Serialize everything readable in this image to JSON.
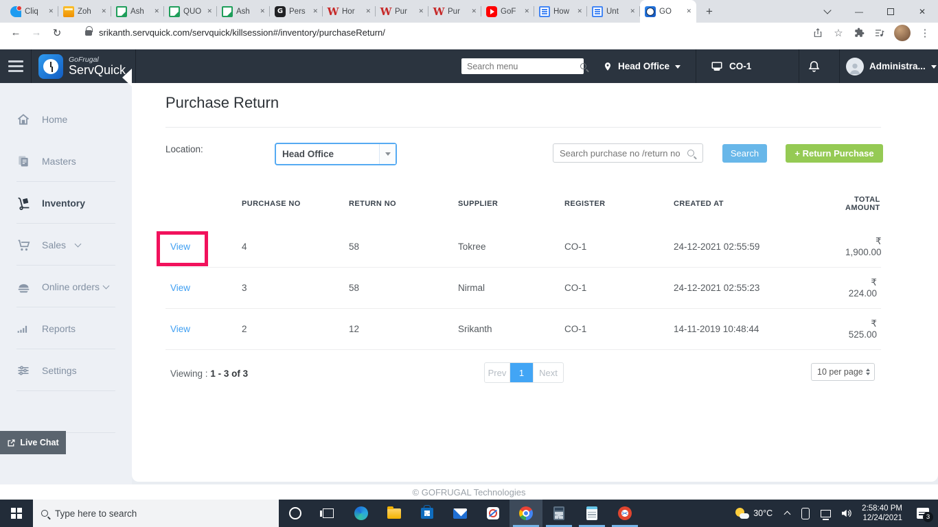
{
  "browser": {
    "tab_strip": {
      "tabs": [
        {
          "label": "Cliq",
          "icon": "cliq"
        },
        {
          "label": "Zoh",
          "icon": "folder"
        },
        {
          "label": "Ash",
          "icon": "sheet"
        },
        {
          "label": "QUO",
          "icon": "sheet"
        },
        {
          "label": "Ash",
          "icon": "sheet"
        },
        {
          "label": "Pers",
          "icon": "g"
        },
        {
          "label": "Hor",
          "icon": "w"
        },
        {
          "label": "Pur",
          "icon": "w"
        },
        {
          "label": "Pur",
          "icon": "w"
        },
        {
          "label": "GoF",
          "icon": "youtube"
        },
        {
          "label": "How",
          "icon": "doc"
        },
        {
          "label": "Unt",
          "icon": "doc"
        },
        {
          "label": "GO",
          "icon": "clock",
          "active": true
        }
      ],
      "new_tab_label": "+",
      "close_glyph": "✕"
    },
    "toolbar": {
      "url": "srikanth.servquick.com/servquick/killsession#/inventory/purchaseReturn/",
      "back": "←",
      "forward": "→",
      "reload": "↻",
      "star": "☆",
      "menu_dots": "⋮"
    }
  },
  "app": {
    "logo": {
      "brand": "GoFrugal",
      "product": "ServQuick"
    },
    "header": {
      "menu_search_placeholder": "Search menu",
      "location": "Head Office",
      "register": "CO-1",
      "user": "Administra..."
    },
    "sidebar": {
      "items": [
        {
          "label": "Home"
        },
        {
          "label": "Masters"
        },
        {
          "label": "Inventory"
        },
        {
          "label": "Sales"
        },
        {
          "label": "Online orders"
        },
        {
          "label": "Reports"
        },
        {
          "label": "Settings"
        }
      ],
      "live_chat": "Live Chat"
    },
    "main": {
      "title": "Purchase Return",
      "location_label": "Location:",
      "location_value": "Head Office",
      "search_placeholder": "Search purchase no /return no",
      "search_button": "Search",
      "return_button": "+ Return Purchase",
      "table": {
        "columns": [
          "PURCHASE NO",
          "RETURN NO",
          "SUPPLIER",
          "REGISTER",
          "CREATED AT",
          "TOTAL AMOUNT"
        ],
        "view_label": "View",
        "rows": [
          {
            "purchase_no": "4",
            "return_no": "58",
            "supplier": "Tokree",
            "register": "CO-1",
            "created_at": "24-12-2021 02:55:59",
            "total": "₹ 1,900.00"
          },
          {
            "purchase_no": "3",
            "return_no": "58",
            "supplier": "Nirmal",
            "register": "CO-1",
            "created_at": "24-12-2021 02:55:23",
            "total": "₹ 224.00"
          },
          {
            "purchase_no": "2",
            "return_no": "12",
            "supplier": "Srikanth",
            "register": "CO-1",
            "created_at": "14-11-2019 10:48:44",
            "total": "₹ 525.00"
          }
        ]
      },
      "pagination": {
        "viewing_label": "Viewing :",
        "viewing_value": "1 - 3 of 3",
        "prev": "Prev",
        "page": "1",
        "next": "Next",
        "per_page": "10 per page"
      }
    },
    "footer": "© GOFRUGAL Technologies"
  },
  "taskbar": {
    "search_placeholder": "Type here to search",
    "tray": {
      "temperature": "30°C",
      "time": "2:58:40 PM",
      "date": "12/24/2021",
      "notification_count": "3"
    }
  },
  "colors": {
    "accent_blue": "#55aaf2",
    "button_blue": "#68b7e9",
    "button_green": "#95ca54",
    "link_blue": "#3f9ff2",
    "annotation_pink": "#f1125c",
    "header_dark": "#2b343f",
    "taskbar_dark": "#222c39"
  }
}
